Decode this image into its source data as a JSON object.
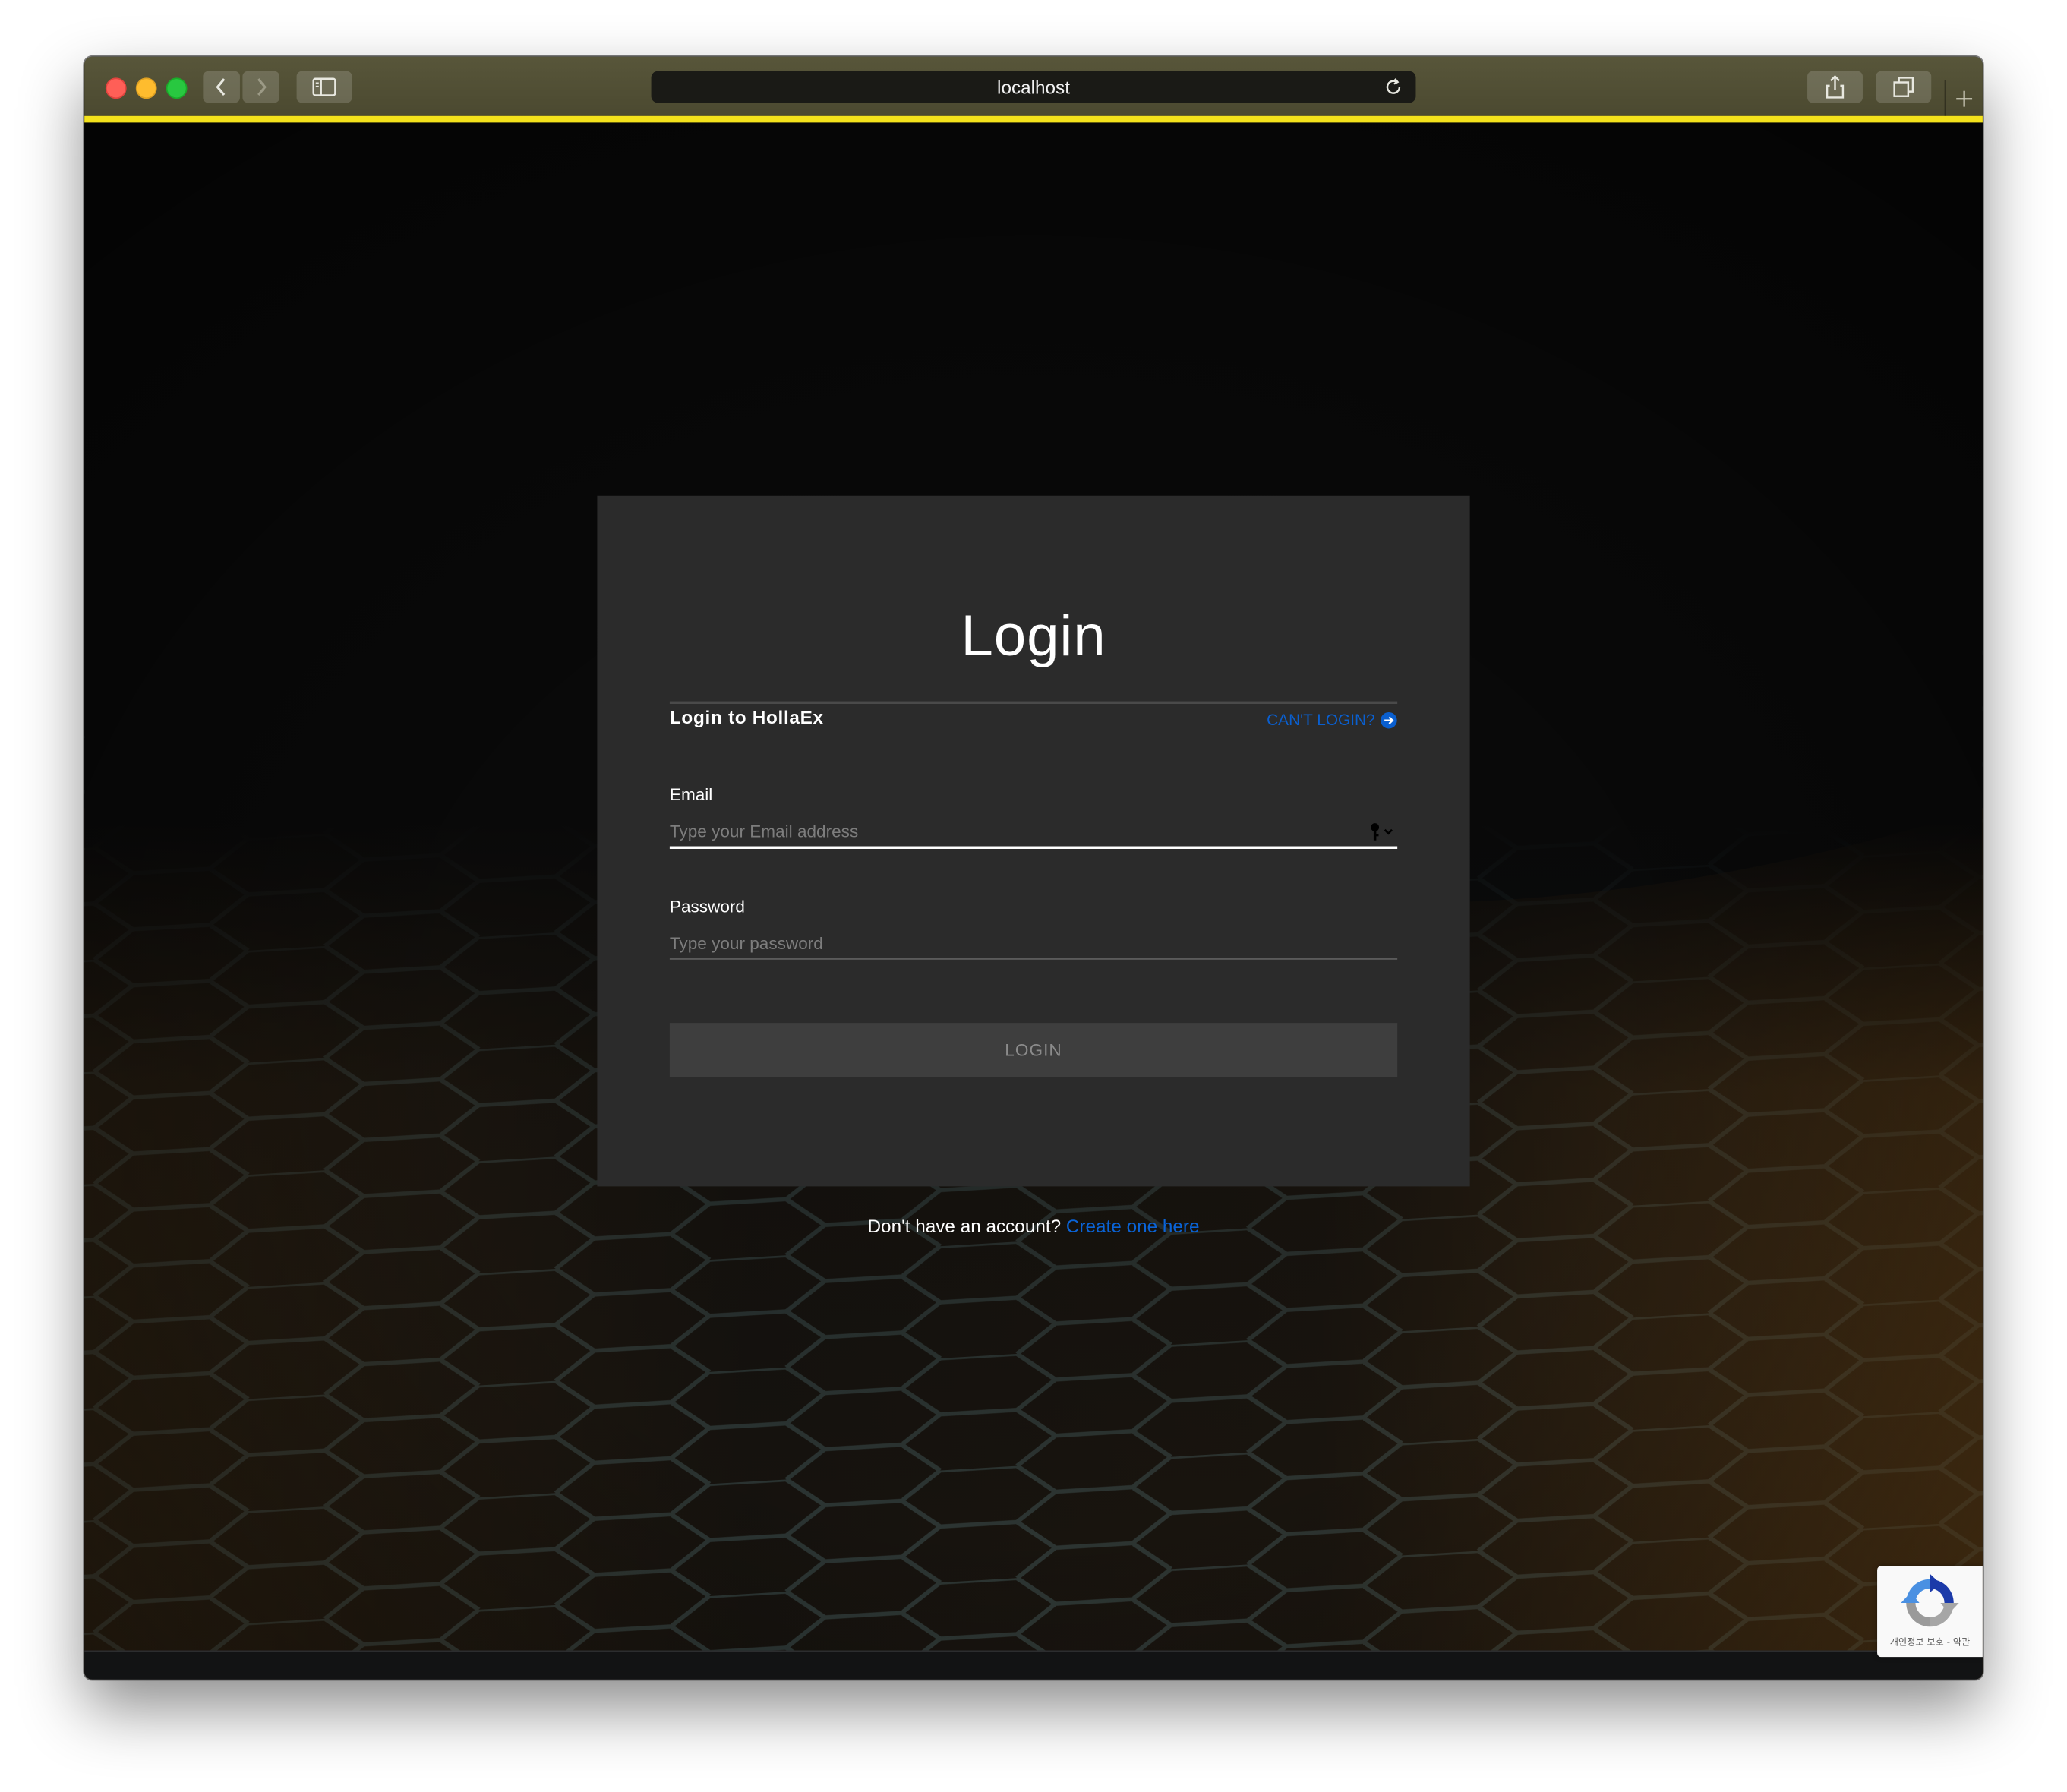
{
  "browser": {
    "address": "localhost"
  },
  "page": {
    "title": "Login",
    "subtitle": "Login to HollaEx",
    "cant_login": "CAN'T LOGIN?",
    "email": {
      "label": "Email",
      "placeholder": "Type your Email address",
      "value": ""
    },
    "password": {
      "label": "Password",
      "placeholder": "Type your password",
      "value": ""
    },
    "login_button": "LOGIN",
    "signup_prompt": "Don't have an account?",
    "signup_link": "Create one here"
  },
  "recaptcha": {
    "terms": "개인정보 보호 - 약관"
  },
  "colors": {
    "accent_bar": "#f4e21c",
    "link": "#0a63d6",
    "card": "#2b2b2b",
    "background": "#090909"
  }
}
